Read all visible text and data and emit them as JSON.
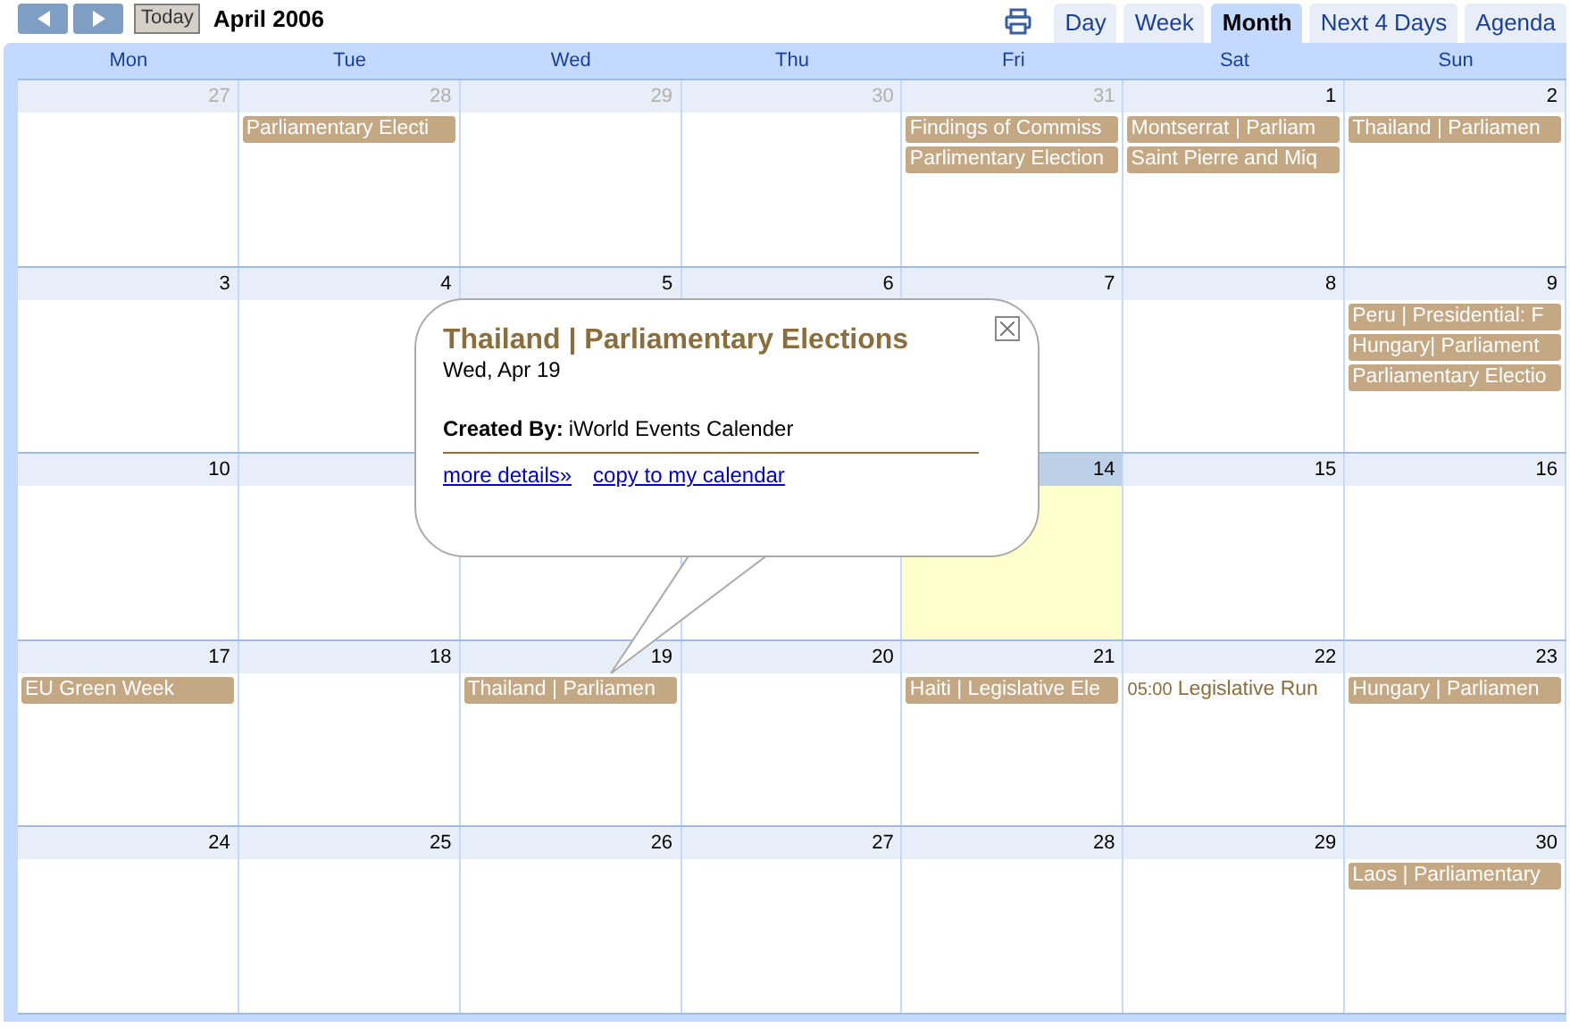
{
  "toolbar": {
    "title": "April 2006",
    "today_label": "Today",
    "views": [
      {
        "label": "Day",
        "selected": false
      },
      {
        "label": "Week",
        "selected": false
      },
      {
        "label": "Month",
        "selected": true
      },
      {
        "label": "Next 4 Days",
        "selected": false
      },
      {
        "label": "Agenda",
        "selected": false
      }
    ]
  },
  "weekdays": [
    "Mon",
    "Tue",
    "Wed",
    "Thu",
    "Fri",
    "Sat",
    "Sun"
  ],
  "weeks": [
    {
      "days": [
        {
          "num": "27",
          "muted": true,
          "today": false
        },
        {
          "num": "28",
          "muted": true,
          "today": false,
          "events": [
            {
              "kind": "bar",
              "title": "Parliamentary Electi"
            }
          ]
        },
        {
          "num": "29",
          "muted": true,
          "today": false
        },
        {
          "num": "30",
          "muted": true,
          "today": false
        },
        {
          "num": "31",
          "muted": true,
          "today": false,
          "events": [
            {
              "kind": "bar",
              "title": "Findings of Commiss"
            },
            {
              "kind": "bar",
              "title": "Parlimentary Election"
            }
          ]
        },
        {
          "num": "1",
          "muted": false,
          "today": false,
          "events": [
            {
              "kind": "bar",
              "title": "Montserrat | Parliam"
            },
            {
              "kind": "bar",
              "title": "Saint Pierre and Miq"
            }
          ]
        },
        {
          "num": "2",
          "muted": false,
          "today": false,
          "events": [
            {
              "kind": "bar",
              "title": "Thailand | Parliamen"
            }
          ]
        }
      ]
    },
    {
      "days": [
        {
          "num": "3",
          "muted": false,
          "today": false
        },
        {
          "num": "4",
          "muted": false,
          "today": false
        },
        {
          "num": "5",
          "muted": false,
          "today": false
        },
        {
          "num": "6",
          "muted": false,
          "today": false
        },
        {
          "num": "7",
          "muted": false,
          "today": false
        },
        {
          "num": "8",
          "muted": false,
          "today": false
        },
        {
          "num": "9",
          "muted": false,
          "today": false,
          "events": [
            {
              "kind": "bar",
              "title": "Peru | Presidential: F"
            },
            {
              "kind": "bar",
              "title": "Hungary| Parliament"
            },
            {
              "kind": "bar",
              "title": "Parliamentary Electio"
            }
          ]
        }
      ]
    },
    {
      "days": [
        {
          "num": "10",
          "muted": false,
          "today": false
        },
        {
          "today": false
        },
        {
          "today": false
        },
        {
          "today": false
        },
        {
          "num": "14",
          "muted": false,
          "today": true
        },
        {
          "num": "15",
          "muted": false,
          "today": false
        },
        {
          "num": "16",
          "muted": false,
          "today": false
        }
      ]
    },
    {
      "days": [
        {
          "num": "17",
          "muted": false,
          "today": false,
          "events": [
            {
              "kind": "bar",
              "title": "EU Green Week"
            }
          ]
        },
        {
          "num": "18",
          "muted": false,
          "today": false
        },
        {
          "num": "19",
          "muted": false,
          "today": false,
          "events": [
            {
              "kind": "bar",
              "title": "Thailand | Parliamen"
            }
          ]
        },
        {
          "num": "20",
          "muted": false,
          "today": false
        },
        {
          "num": "21",
          "muted": false,
          "today": false,
          "events": [
            {
              "kind": "bar",
              "title": "Haiti | Legislative Ele"
            }
          ]
        },
        {
          "num": "22",
          "muted": false,
          "today": false,
          "events": [
            {
              "kind": "timed",
              "time": "05:00",
              "title": "Legislative Run"
            }
          ]
        },
        {
          "num": "23",
          "muted": false,
          "today": false,
          "events": [
            {
              "kind": "bar",
              "title": "Hungary | Parliamen"
            }
          ]
        }
      ]
    },
    {
      "days": [
        {
          "num": "24",
          "muted": false,
          "today": false
        },
        {
          "num": "25",
          "muted": false,
          "today": false
        },
        {
          "num": "26",
          "muted": false,
          "today": false
        },
        {
          "num": "27",
          "muted": false,
          "today": false
        },
        {
          "num": "28",
          "muted": false,
          "today": false
        },
        {
          "num": "29",
          "muted": false,
          "today": false
        },
        {
          "num": "30",
          "muted": false,
          "today": false,
          "events": [
            {
              "kind": "bar",
              "title": "Laos | Parliamentary"
            }
          ]
        }
      ]
    }
  ],
  "popup": {
    "title": "Thailand | Parliamentary Elections",
    "date": "Wed, Apr 19",
    "created_by_label": "Created By:",
    "created_by": "iWorld Events Calender",
    "links": [
      "more details»",
      "copy to my calendar"
    ]
  }
}
